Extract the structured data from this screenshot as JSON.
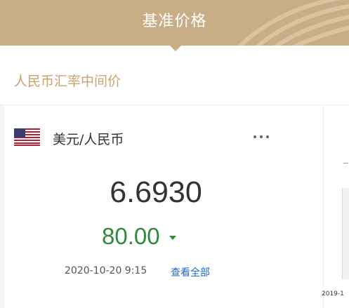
{
  "header": {
    "title": "基准价格",
    "bg_color": "#c8ae86"
  },
  "section": {
    "title": "人民币汇率中间价",
    "color": "#c9a36f"
  },
  "card": {
    "flag": "us-flag-icon",
    "pair": "美元/人民币",
    "more_icon": "ellipsis-icon",
    "rate": "6.6930",
    "change": "80.00",
    "change_direction": "down",
    "change_color": "#2f8a3e",
    "timestamp": "2020-10-20 9:15",
    "view_all": "查看全部",
    "link_color": "#1f69c7"
  },
  "chart_edge": {
    "date_label": "2019-1"
  }
}
